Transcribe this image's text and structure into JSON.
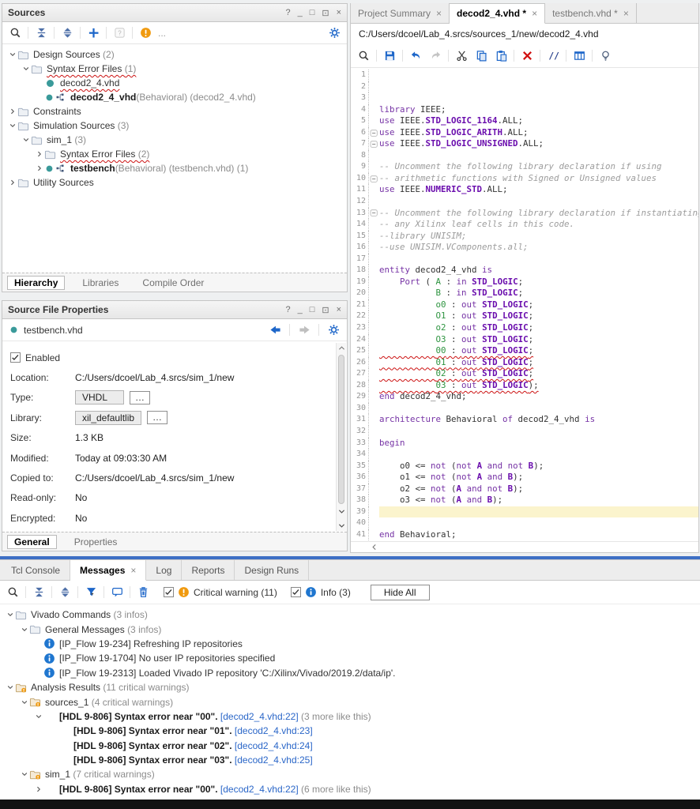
{
  "sources": {
    "title": "Sources",
    "more": "...",
    "toolbar": [
      [
        "search"
      ],
      [
        "collapse-all"
      ],
      [
        "expand-all"
      ],
      [
        "add"
      ],
      [
        "help"
      ],
      [
        "warning"
      ]
    ],
    "tree": [
      {
        "d": 0,
        "e": "v",
        "i": "folder",
        "seg": [
          [
            "t",
            "Design Sources "
          ],
          [
            "g",
            "(2)"
          ]
        ]
      },
      {
        "d": 1,
        "e": "v",
        "i": "folder",
        "err": true,
        "seg": [
          [
            "t",
            "Syntax Error Files "
          ],
          [
            "g",
            "(1)"
          ]
        ]
      },
      {
        "d": 2,
        "e": "",
        "i": "vhdl",
        "err": true,
        "seg": [
          [
            "t",
            "decod2_4.vhd"
          ]
        ]
      },
      {
        "d": 2,
        "e": "",
        "i": "module",
        "seg": [
          [
            "b",
            "decod2_4_vhd"
          ],
          [
            "g",
            "(Behavioral) (decod2_4.vhd)"
          ]
        ]
      },
      {
        "d": 0,
        "e": ">",
        "i": "folder",
        "seg": [
          [
            "t",
            "Constraints"
          ]
        ]
      },
      {
        "d": 0,
        "e": "v",
        "i": "folder",
        "seg": [
          [
            "t",
            "Simulation Sources "
          ],
          [
            "g",
            "(3)"
          ]
        ]
      },
      {
        "d": 1,
        "e": "v",
        "i": "folder",
        "seg": [
          [
            "t",
            "sim_1 "
          ],
          [
            "g",
            "(3)"
          ]
        ]
      },
      {
        "d": 2,
        "e": ">",
        "i": "folder",
        "err": true,
        "seg": [
          [
            "t",
            "Syntax Error Files "
          ],
          [
            "g",
            "(2)"
          ]
        ]
      },
      {
        "d": 2,
        "e": ">",
        "i": "module",
        "seg": [
          [
            "b",
            "testbench"
          ],
          [
            "g",
            "(Behavioral) (testbench.vhd) (1)"
          ]
        ]
      },
      {
        "d": 0,
        "e": ">",
        "i": "folder",
        "seg": [
          [
            "t",
            "Utility Sources"
          ]
        ]
      }
    ],
    "tabs": [
      {
        "label": "Hierarchy",
        "active": true
      },
      {
        "label": "Libraries"
      },
      {
        "label": "Compile Order"
      }
    ]
  },
  "properties": {
    "title": "Source File Properties",
    "file": "testbench.vhd",
    "nav": [
      "back",
      "forward",
      "settings"
    ],
    "enabled": "Enabled",
    "fields": [
      {
        "label": "Location:",
        "value": "C:/Users/dcoel/Lab_4.srcs/sim_1/new"
      },
      {
        "label": "Type:",
        "value": "VHDL",
        "box": true
      },
      {
        "label": "Library:",
        "value": "xil_defaultlib",
        "box": true
      },
      {
        "label": "Size:",
        "value": "1.3 KB"
      },
      {
        "label": "Modified:",
        "value": "Today at 09:03:30 AM"
      },
      {
        "label": "Copied to:",
        "value": "C:/Users/dcoel/Lab_4.srcs/sim_1/new"
      },
      {
        "label": "Read-only:",
        "value": "No"
      },
      {
        "label": "Encrypted:",
        "value": "No"
      }
    ],
    "tabs": [
      {
        "label": "General",
        "active": true
      },
      {
        "label": "Properties"
      }
    ]
  },
  "editor": {
    "tabs": [
      {
        "label": "Project Summary",
        "active": false
      },
      {
        "label": "decod2_4.vhd *",
        "active": true
      },
      {
        "label": "testbench.vhd *",
        "active": false
      }
    ],
    "path": "C:/Users/dcoel/Lab_4.srcs/sources_1/new/decod2_4.vhd",
    "toolbar": [
      [
        "search"
      ],
      [
        "save"
      ],
      [
        "undo",
        "redo"
      ],
      [
        "cut",
        "copy",
        "paste"
      ],
      [
        "delete"
      ],
      [
        "comment"
      ],
      [
        "columns"
      ],
      [
        "lightbulb"
      ]
    ],
    "lines": [
      {
        "t": []
      },
      {
        "t": []
      },
      {
        "t": []
      },
      {
        "t": [
          [
            "k",
            "library"
          ],
          [
            "p",
            " IEEE;"
          ]
        ]
      },
      {
        "t": [
          [
            "k",
            "use"
          ],
          [
            "p",
            " IEEE."
          ],
          [
            "y",
            "STD_LOGIC_1164"
          ],
          [
            "p",
            ".ALL;"
          ]
        ]
      },
      {
        "f": 1,
        "t": [
          [
            "k",
            "use"
          ],
          [
            "p",
            " IEEE."
          ],
          [
            "y",
            "STD_LOGIC_ARITH"
          ],
          [
            "p",
            ".ALL;"
          ]
        ]
      },
      {
        "f": 1,
        "t": [
          [
            "k",
            "use"
          ],
          [
            "p",
            " IEEE."
          ],
          [
            "y",
            "STD_LOGIC_UNSIGNED"
          ],
          [
            "p",
            ".ALL;"
          ]
        ]
      },
      {
        "t": []
      },
      {
        "t": [
          [
            "c",
            "-- Uncomment the following library declaration if using"
          ]
        ]
      },
      {
        "f": 1,
        "t": [
          [
            "c",
            "-- arithmetic functions with Signed or Unsigned values"
          ]
        ]
      },
      {
        "t": [
          [
            "k",
            "use"
          ],
          [
            "p",
            " IEEE."
          ],
          [
            "y",
            "NUMERIC_STD"
          ],
          [
            "p",
            ".ALL;"
          ]
        ]
      },
      {
        "t": []
      },
      {
        "f": 1,
        "t": [
          [
            "c",
            "-- Uncomment the following library declaration if instantiating"
          ]
        ]
      },
      {
        "t": [
          [
            "c",
            "-- any Xilinx leaf cells in this code."
          ]
        ]
      },
      {
        "t": [
          [
            "c",
            "--library UNISIM;"
          ]
        ]
      },
      {
        "t": [
          [
            "c",
            "--use UNISIM.VComponents.all;"
          ]
        ]
      },
      {
        "t": []
      },
      {
        "t": [
          [
            "k",
            "entity"
          ],
          [
            "p",
            " decod2_4_vhd "
          ],
          [
            "k",
            "is"
          ]
        ]
      },
      {
        "t": [
          [
            "p",
            "    "
          ],
          [
            "k",
            "Port"
          ],
          [
            "p",
            " ( "
          ],
          [
            "s",
            "A"
          ],
          [
            "p",
            " : "
          ],
          [
            "k",
            "in"
          ],
          [
            "p",
            " "
          ],
          [
            "y",
            "STD_LOGIC"
          ],
          [
            "p",
            ";"
          ]
        ]
      },
      {
        "t": [
          [
            "p",
            "           "
          ],
          [
            "s",
            "B"
          ],
          [
            "p",
            " : "
          ],
          [
            "k",
            "in"
          ],
          [
            "p",
            " "
          ],
          [
            "y",
            "STD_LOGIC"
          ],
          [
            "p",
            ";"
          ]
        ]
      },
      {
        "t": [
          [
            "p",
            "           "
          ],
          [
            "s",
            "o0"
          ],
          [
            "p",
            " : "
          ],
          [
            "k",
            "out"
          ],
          [
            "p",
            " "
          ],
          [
            "y",
            "STD_LOGIC"
          ],
          [
            "p",
            ";"
          ]
        ]
      },
      {
        "t": [
          [
            "p",
            "           "
          ],
          [
            "s",
            "O1"
          ],
          [
            "p",
            " : "
          ],
          [
            "k",
            "out"
          ],
          [
            "p",
            " "
          ],
          [
            "y",
            "STD_LOGIC"
          ],
          [
            "p",
            ";"
          ]
        ]
      },
      {
        "t": [
          [
            "p",
            "           "
          ],
          [
            "s",
            "o2"
          ],
          [
            "p",
            " : "
          ],
          [
            "k",
            "out"
          ],
          [
            "p",
            " "
          ],
          [
            "y",
            "STD_LOGIC"
          ],
          [
            "p",
            ";"
          ]
        ]
      },
      {
        "t": [
          [
            "p",
            "           "
          ],
          [
            "s",
            "O3"
          ],
          [
            "p",
            " : "
          ],
          [
            "k",
            "out"
          ],
          [
            "p",
            " "
          ],
          [
            "y",
            "STD_LOGIC"
          ],
          [
            "p",
            ";"
          ]
        ]
      },
      {
        "e": 1,
        "t": [
          [
            "p",
            "           "
          ],
          [
            "s",
            "00"
          ],
          [
            "p",
            " : "
          ],
          [
            "k",
            "out"
          ],
          [
            "p",
            " "
          ],
          [
            "y",
            "STD_LOGIC"
          ],
          [
            "p",
            ";"
          ]
        ]
      },
      {
        "e": 1,
        "t": [
          [
            "p",
            "           "
          ],
          [
            "s",
            "01"
          ],
          [
            "p",
            " : "
          ],
          [
            "k",
            "out"
          ],
          [
            "p",
            " "
          ],
          [
            "y",
            "STD_LOGIC"
          ],
          [
            "p",
            ";"
          ]
        ]
      },
      {
        "e": 1,
        "t": [
          [
            "p",
            "           "
          ],
          [
            "s",
            "02"
          ],
          [
            "p",
            " : "
          ],
          [
            "k",
            "out"
          ],
          [
            "p",
            " "
          ],
          [
            "y",
            "STD_LOGIC"
          ],
          [
            "p",
            ";"
          ]
        ]
      },
      {
        "e": 1,
        "t": [
          [
            "p",
            "           "
          ],
          [
            "s",
            "03"
          ],
          [
            "p",
            " : "
          ],
          [
            "k",
            "out"
          ],
          [
            "p",
            " "
          ],
          [
            "y",
            "STD_LOGIC"
          ],
          [
            "p",
            ");"
          ]
        ]
      },
      {
        "t": [
          [
            "k",
            "end"
          ],
          [
            "p",
            " decod2_4_vhd;"
          ]
        ]
      },
      {
        "t": []
      },
      {
        "t": [
          [
            "k",
            "architecture"
          ],
          [
            "p",
            " Behavioral "
          ],
          [
            "k",
            "of"
          ],
          [
            "p",
            " decod2_4_vhd "
          ],
          [
            "k",
            "is"
          ]
        ]
      },
      {
        "t": []
      },
      {
        "t": [
          [
            "k",
            "begin"
          ]
        ]
      },
      {
        "t": []
      },
      {
        "t": [
          [
            "p",
            "    o0 <= "
          ],
          [
            "k",
            "not"
          ],
          [
            "p",
            " ("
          ],
          [
            "k",
            "not"
          ],
          [
            "p",
            " "
          ],
          [
            "y",
            "A"
          ],
          [
            "p",
            " "
          ],
          [
            "k",
            "and"
          ],
          [
            "p",
            " "
          ],
          [
            "k",
            "not"
          ],
          [
            "p",
            " "
          ],
          [
            "y",
            "B"
          ],
          [
            "p",
            ");"
          ]
        ]
      },
      {
        "t": [
          [
            "p",
            "    o1 <= "
          ],
          [
            "k",
            "not"
          ],
          [
            "p",
            " ("
          ],
          [
            "k",
            "not"
          ],
          [
            "p",
            " "
          ],
          [
            "y",
            "A"
          ],
          [
            "p",
            " "
          ],
          [
            "k",
            "and"
          ],
          [
            "p",
            " "
          ],
          [
            "y",
            "B"
          ],
          [
            "p",
            ");"
          ]
        ]
      },
      {
        "t": [
          [
            "p",
            "    o2 <= "
          ],
          [
            "k",
            "not"
          ],
          [
            "p",
            " ("
          ],
          [
            "y",
            "A"
          ],
          [
            "p",
            " "
          ],
          [
            "k",
            "and"
          ],
          [
            "p",
            " "
          ],
          [
            "k",
            "not"
          ],
          [
            "p",
            " "
          ],
          [
            "y",
            "B"
          ],
          [
            "p",
            ");"
          ]
        ]
      },
      {
        "t": [
          [
            "p",
            "    o3 <= "
          ],
          [
            "k",
            "not"
          ],
          [
            "p",
            " ("
          ],
          [
            "y",
            "A"
          ],
          [
            "p",
            " "
          ],
          [
            "k",
            "and"
          ],
          [
            "p",
            " "
          ],
          [
            "y",
            "B"
          ],
          [
            "p",
            ");"
          ]
        ]
      },
      {
        "h": 1,
        "t": []
      },
      {
        "t": []
      },
      {
        "t": [
          [
            "k",
            "end"
          ],
          [
            "p",
            " Behavioral;"
          ]
        ]
      }
    ]
  },
  "messages": {
    "tabs": [
      {
        "label": "Tcl Console"
      },
      {
        "label": "Messages",
        "active": true,
        "close": true
      },
      {
        "label": "Log"
      },
      {
        "label": "Reports"
      },
      {
        "label": "Design Runs"
      }
    ],
    "toolbar": [
      [
        "search"
      ],
      [
        "collapse-all"
      ],
      [
        "expand-all"
      ],
      [
        "filter"
      ],
      [
        "message-settings"
      ],
      [
        "delete-messages"
      ]
    ],
    "critical_label": "Critical warning (11)",
    "info_label": "Info (3)",
    "hide_all": "Hide All",
    "tree": [
      {
        "d": 0,
        "e": "v",
        "i": "folder",
        "seg": [
          [
            "t",
            "Vivado Commands "
          ],
          [
            "g",
            "(3 infos)"
          ]
        ]
      },
      {
        "d": 1,
        "e": "v",
        "i": "folder",
        "seg": [
          [
            "t",
            "General Messages "
          ],
          [
            "g",
            "(3 infos)"
          ]
        ]
      },
      {
        "d": 2,
        "e": "",
        "i": "info",
        "seg": [
          [
            "t",
            "[IP_Flow 19-234] Refreshing IP repositories"
          ]
        ]
      },
      {
        "d": 2,
        "e": "",
        "i": "info",
        "seg": [
          [
            "t",
            "[IP_Flow 19-1704] No user IP repositories specified"
          ]
        ]
      },
      {
        "d": 2,
        "e": "",
        "i": "info",
        "seg": [
          [
            "t",
            "[IP_Flow 19-2313] Loaded Vivado IP repository 'C:/Xilinx/Vivado/2019.2/data/ip'."
          ]
        ]
      },
      {
        "d": 0,
        "e": "v",
        "i": "folderw",
        "seg": [
          [
            "t",
            "Analysis Results "
          ],
          [
            "g",
            "(11 critical warnings)"
          ]
        ]
      },
      {
        "d": 1,
        "e": "v",
        "i": "folderw",
        "seg": [
          [
            "t",
            "sources_1 "
          ],
          [
            "g",
            "(4 critical warnings)"
          ]
        ]
      },
      {
        "d": 2,
        "e": "v",
        "i": "warn",
        "seg": [
          [
            "w",
            "[HDL 9-806] Syntax error near \"00\". "
          ],
          [
            "l",
            "[decod2_4.vhd:22]"
          ],
          [
            "g",
            " (3 more like this)"
          ]
        ]
      },
      {
        "d": 3,
        "e": "",
        "i": "warn",
        "seg": [
          [
            "w",
            "[HDL 9-806] Syntax error near \"01\". "
          ],
          [
            "l",
            "[decod2_4.vhd:23]"
          ]
        ]
      },
      {
        "d": 3,
        "e": "",
        "i": "warn",
        "seg": [
          [
            "w",
            "[HDL 9-806] Syntax error near \"02\". "
          ],
          [
            "l",
            "[decod2_4.vhd:24]"
          ]
        ]
      },
      {
        "d": 3,
        "e": "",
        "i": "warn",
        "seg": [
          [
            "w",
            "[HDL 9-806] Syntax error near \"03\". "
          ],
          [
            "l",
            "[decod2_4.vhd:25]"
          ]
        ]
      },
      {
        "d": 1,
        "e": "v",
        "i": "folderw",
        "seg": [
          [
            "t",
            "sim_1 "
          ],
          [
            "g",
            "(7 critical warnings)"
          ]
        ]
      },
      {
        "d": 2,
        "e": ">",
        "i": "warn",
        "seg": [
          [
            "w",
            "[HDL 9-806] Syntax error near \"00\". "
          ],
          [
            "l",
            "[decod2_4.vhd:22]"
          ],
          [
            "g",
            " (6 more like this)"
          ]
        ]
      }
    ]
  }
}
